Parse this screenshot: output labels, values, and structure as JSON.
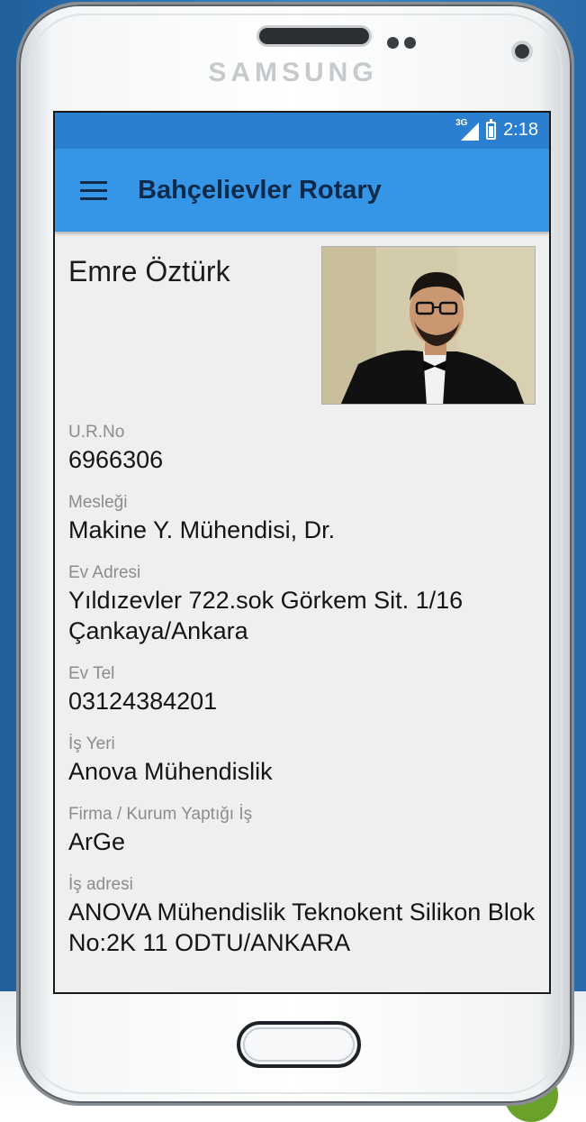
{
  "device": {
    "brand": "SAMSUNG"
  },
  "status_bar": {
    "network": "3G",
    "time": "2:18"
  },
  "app_bar": {
    "title": "Bahçelievler Rotary"
  },
  "profile": {
    "name": "Emre Öztürk",
    "fields": [
      {
        "label": "U.R.No",
        "value": "6966306"
      },
      {
        "label": "Mesleği",
        "value": "Makine Y. Mühendisi, Dr."
      },
      {
        "label": "Ev Adresi",
        "value": "Yıldızevler 722.sok Görkem Sit. 1/16 Çankaya/Ankara"
      },
      {
        "label": "Ev Tel",
        "value": "03124384201"
      },
      {
        "label": "İş Yeri",
        "value": "Anova Mühendislik"
      },
      {
        "label": "Firma / Kurum Yaptığı İş",
        "value": "ArGe"
      },
      {
        "label": "İş adresi",
        "value": "ANOVA Mühendislik Teknokent Silikon Blok No:2K 11 ODTU/ANKARA"
      }
    ]
  },
  "colors": {
    "status_bar": "#2b7fd0",
    "app_bar": "#3595e6",
    "title_text": "#0d2a4a",
    "label_text": "#8c8c8c"
  }
}
